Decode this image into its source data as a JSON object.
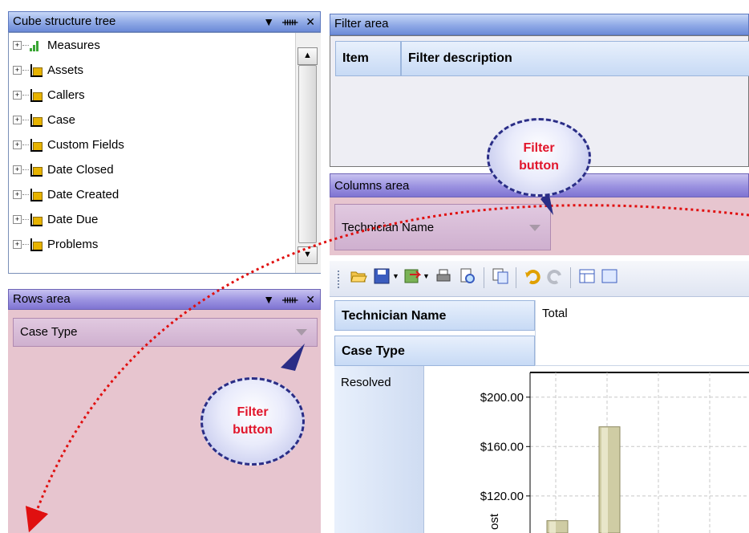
{
  "cube_tree": {
    "title": "Cube structure tree",
    "items": [
      {
        "label": "Measures",
        "icon": "bar-chart-icon"
      },
      {
        "label": "Assets",
        "icon": "dimension-cube-icon"
      },
      {
        "label": "Callers",
        "icon": "dimension-cube-icon"
      },
      {
        "label": "Case",
        "icon": "dimension-cube-icon"
      },
      {
        "label": "Custom Fields",
        "icon": "dimension-cube-icon"
      },
      {
        "label": "Date Closed",
        "icon": "dimension-cube-icon"
      },
      {
        "label": "Date Created",
        "icon": "dimension-cube-icon"
      },
      {
        "label": "Date Due",
        "icon": "dimension-cube-icon"
      },
      {
        "label": "Problems",
        "icon": "dimension-cube-icon"
      }
    ]
  },
  "filter_area": {
    "title": "Filter area",
    "col_item": "Item",
    "col_desc": "Filter description"
  },
  "columns_area": {
    "title": "Columns area",
    "field": "Technician Name"
  },
  "rows_area": {
    "title": "Rows area",
    "field": "Case Type"
  },
  "callouts": {
    "line1": "Filter",
    "line2": "button"
  },
  "pivot": {
    "col_header": "Technician Name",
    "row_header": "Case Type",
    "total_label": "Total",
    "row_value": "Resolved"
  },
  "chart_data": {
    "type": "bar",
    "yticks": [
      "$200.00",
      "$160.00",
      "$120.00"
    ],
    "ylabel_partial": "ost",
    "values": [
      100,
      176
    ],
    "ylim": [
      90,
      220
    ]
  },
  "colors": {
    "header_blue": "#8fa9e6",
    "pink_area": "#e6c3cd",
    "callout_text": "#e1152b",
    "arrow_red": "#e01010"
  }
}
